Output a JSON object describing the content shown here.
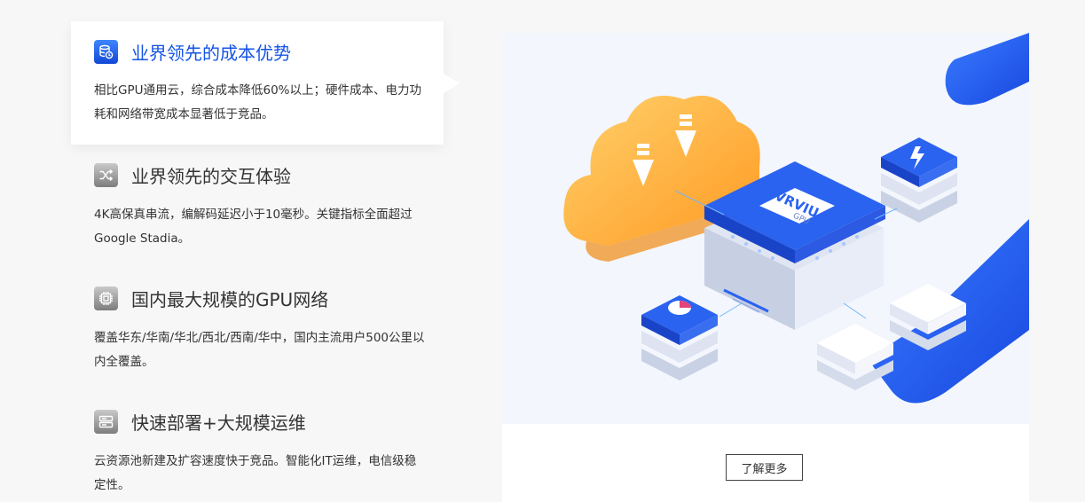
{
  "features": [
    {
      "title": "业界领先的成本优势",
      "desc": "相比GPU通用云，综合成本降低60%以上；硬件成本、电力功耗和网络带宽成本显著低于竞品。",
      "icon": "cost-db-icon",
      "active": true
    },
    {
      "title": "业界领先的交互体验",
      "desc": "4K高保真串流，编解码延迟小于10毫秒。关键指标全面超过Google Stadia。",
      "icon": "shuffle-icon",
      "active": false
    },
    {
      "title": "国内最大规模的GPU网络",
      "desc": "覆盖华东/华南/华北/西北/西南/华中，国内主流用户500公里以内全覆盖。",
      "icon": "chip-icon",
      "active": false
    },
    {
      "title": "快速部署+大规模运维",
      "desc": "云资源池新建及扩容速度快于竞品。智能化IT运维，电信级稳定性。",
      "icon": "server-icon",
      "active": false
    }
  ],
  "illustration": {
    "chip_brand": "VRVIU",
    "chip_sub": "GPU"
  },
  "more_label": "了解更多",
  "colors": {
    "accent": "#1554e6",
    "cloud": "#ffa733",
    "panel_bg": "#f3f6fd"
  }
}
